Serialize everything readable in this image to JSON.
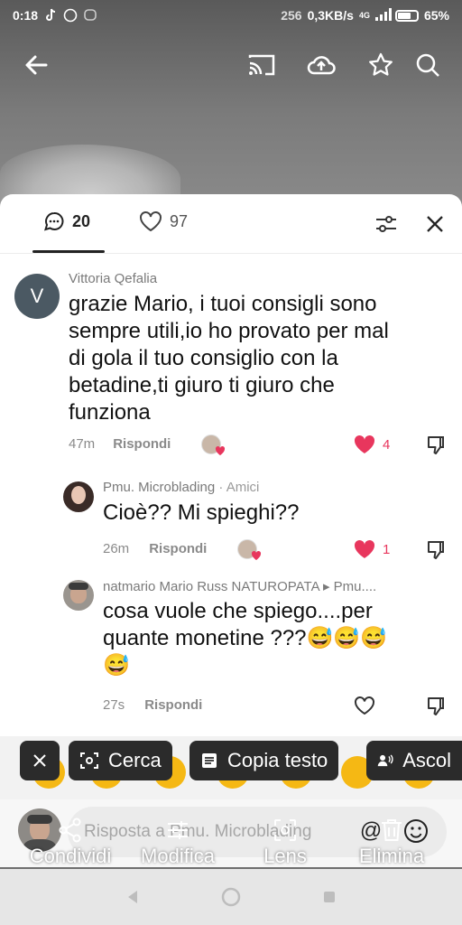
{
  "status_bar": {
    "time": "0:18",
    "network_speed": "0,3KB/s",
    "network_prefix": "256",
    "network_type": "4G",
    "battery": "65%"
  },
  "header_icons": [
    "back-arrow-icon",
    "cast-icon",
    "upload-icon",
    "star-icon",
    "search-icon"
  ],
  "comments_sheet": {
    "tabs": {
      "comments_count": "20",
      "likes_count": "97"
    },
    "comments": [
      {
        "author": "Vittoria Qefalia",
        "avatar_letter": "V",
        "text_lines": [
          "grazie Mario, i tuoi consigli sono",
          "sempre utili,io ho provato per mal",
          "di gola il tuo consiglio con la",
          "betadine,ti giuro ti giuro che",
          "funziona"
        ],
        "age": "47m",
        "reply_label": "Rispondi",
        "likes": "4"
      },
      {
        "author": "Pmu. Microblading",
        "tag": "· Amici",
        "text_lines": [
          "Cioè?? Mi spieghi??"
        ],
        "age": "26m",
        "reply_label": "Rispondi",
        "likes": "1"
      },
      {
        "author": "natmario Mario Russ NATUROPATA ▸ Pmu....",
        "text_lines": [
          "cosa vuole che spiego....per",
          "quante monetine ???😅😅😅",
          "😅"
        ],
        "age": "27s",
        "reply_label": "Rispondi"
      }
    ]
  },
  "selection_toolbar": {
    "close_icon": "close-icon",
    "search_label": "Cerca",
    "copy_label": "Copia testo",
    "listen_label": "Ascol"
  },
  "reply_bar": {
    "placeholder": "Risposta a Pmu. Microblading",
    "mention_symbol": "@"
  },
  "action_menu": {
    "share": "Condividi",
    "edit": "Modifica",
    "lens": "Lens",
    "delete": "Elimina"
  }
}
